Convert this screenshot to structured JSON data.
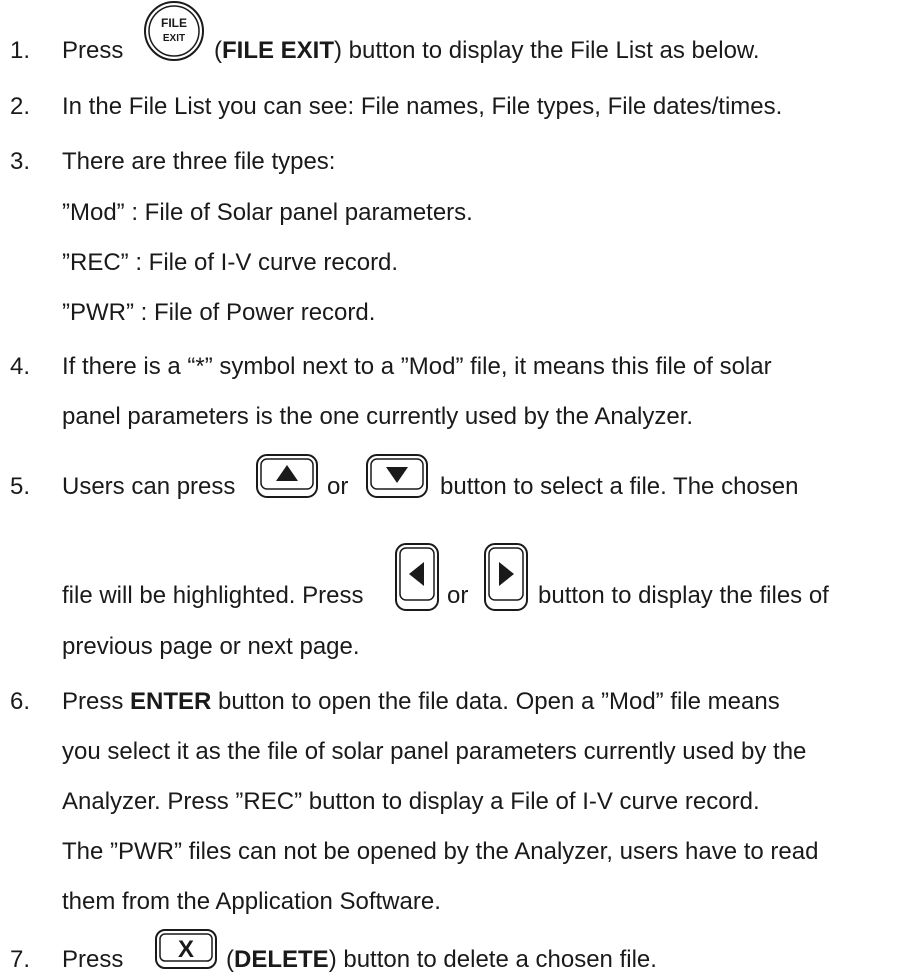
{
  "items": [
    {
      "num": "1.",
      "press": "Press",
      "paren_open": "(",
      "bold": "FILE EXIT",
      "paren_close": ")",
      "rest": " button to display the File List as below.",
      "icon": {
        "name": "file-exit-button-icon",
        "text_top": "FILE",
        "text_bottom": "EXIT"
      }
    },
    {
      "num": "2.",
      "text": "In the File List you can see: File names, File types, File dates/times."
    },
    {
      "num": "3.",
      "text": "There are three file types:",
      "sub": [
        "”Mod” : File of Solar panel parameters.",
        "”REC” : File of I-V curve record.",
        "”PWR” : File of Power record."
      ]
    },
    {
      "num": "4.",
      "lines": [
        "If there is a “*” symbol next to a ”Mod” file, it means this file of solar",
        "panel parameters is the one currently used by the Analyzer."
      ]
    },
    {
      "num": "5.",
      "a1": "Users can press",
      "a2": "or",
      "a3": "button to select a file.   The chosen",
      "b1": "file will be highlighted. Press",
      "b2": "or",
      "b3": "button to display the files of",
      "c": "previous page or next page.",
      "icons": [
        "up-arrow-button-icon",
        "down-arrow-button-icon",
        "left-arrow-button-icon",
        "right-arrow-button-icon"
      ]
    },
    {
      "num": "6.",
      "press": "Press ",
      "bold": "ENTER",
      "rest": " button to open the file data. Open a ”Mod” file means",
      "lines": [
        "you select it as the file of solar panel parameters currently used by the",
        "Analyzer. Press ”REC” button to display a File of I-V curve record.",
        "The ”PWR” files can not be opened by the Analyzer, users have to read",
        "them from the Application Software."
      ]
    },
    {
      "num": "7.",
      "press": "Press",
      "paren_open": "(",
      "bold": "DELETE",
      "paren_close": ")",
      "rest": " button to delete a chosen file.",
      "icon": {
        "name": "delete-x-button-icon",
        "glyph": "X"
      }
    }
  ]
}
